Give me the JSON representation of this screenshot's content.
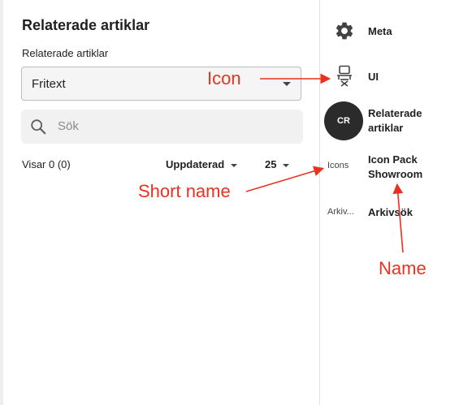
{
  "main": {
    "title": "Relaterade artiklar",
    "field_label": "Relaterade artiklar",
    "select_value": "Fritext",
    "search_placeholder": "Sök",
    "result_count": "Visar 0 (0)",
    "sort_label": "Uppdaterad",
    "page_size": "25"
  },
  "sidebar": {
    "items": [
      {
        "label": "Meta",
        "icon": "gear-icon"
      },
      {
        "label": "UI",
        "icon": "ui-icon"
      },
      {
        "label": "Relaterade artiklar",
        "avatar_text": "CR"
      },
      {
        "label": "Icon Pack Showroom",
        "short_name": "Icons"
      },
      {
        "label": "Arkivsök",
        "short_name": "Arkiv..."
      }
    ]
  },
  "annotations": {
    "icon": "Icon",
    "short_name": "Short name",
    "name": "Name"
  },
  "colors": {
    "annotation": "#e8321f",
    "avatar_bg": "#2b2b2b",
    "search_bg": "#f1f1f1"
  }
}
